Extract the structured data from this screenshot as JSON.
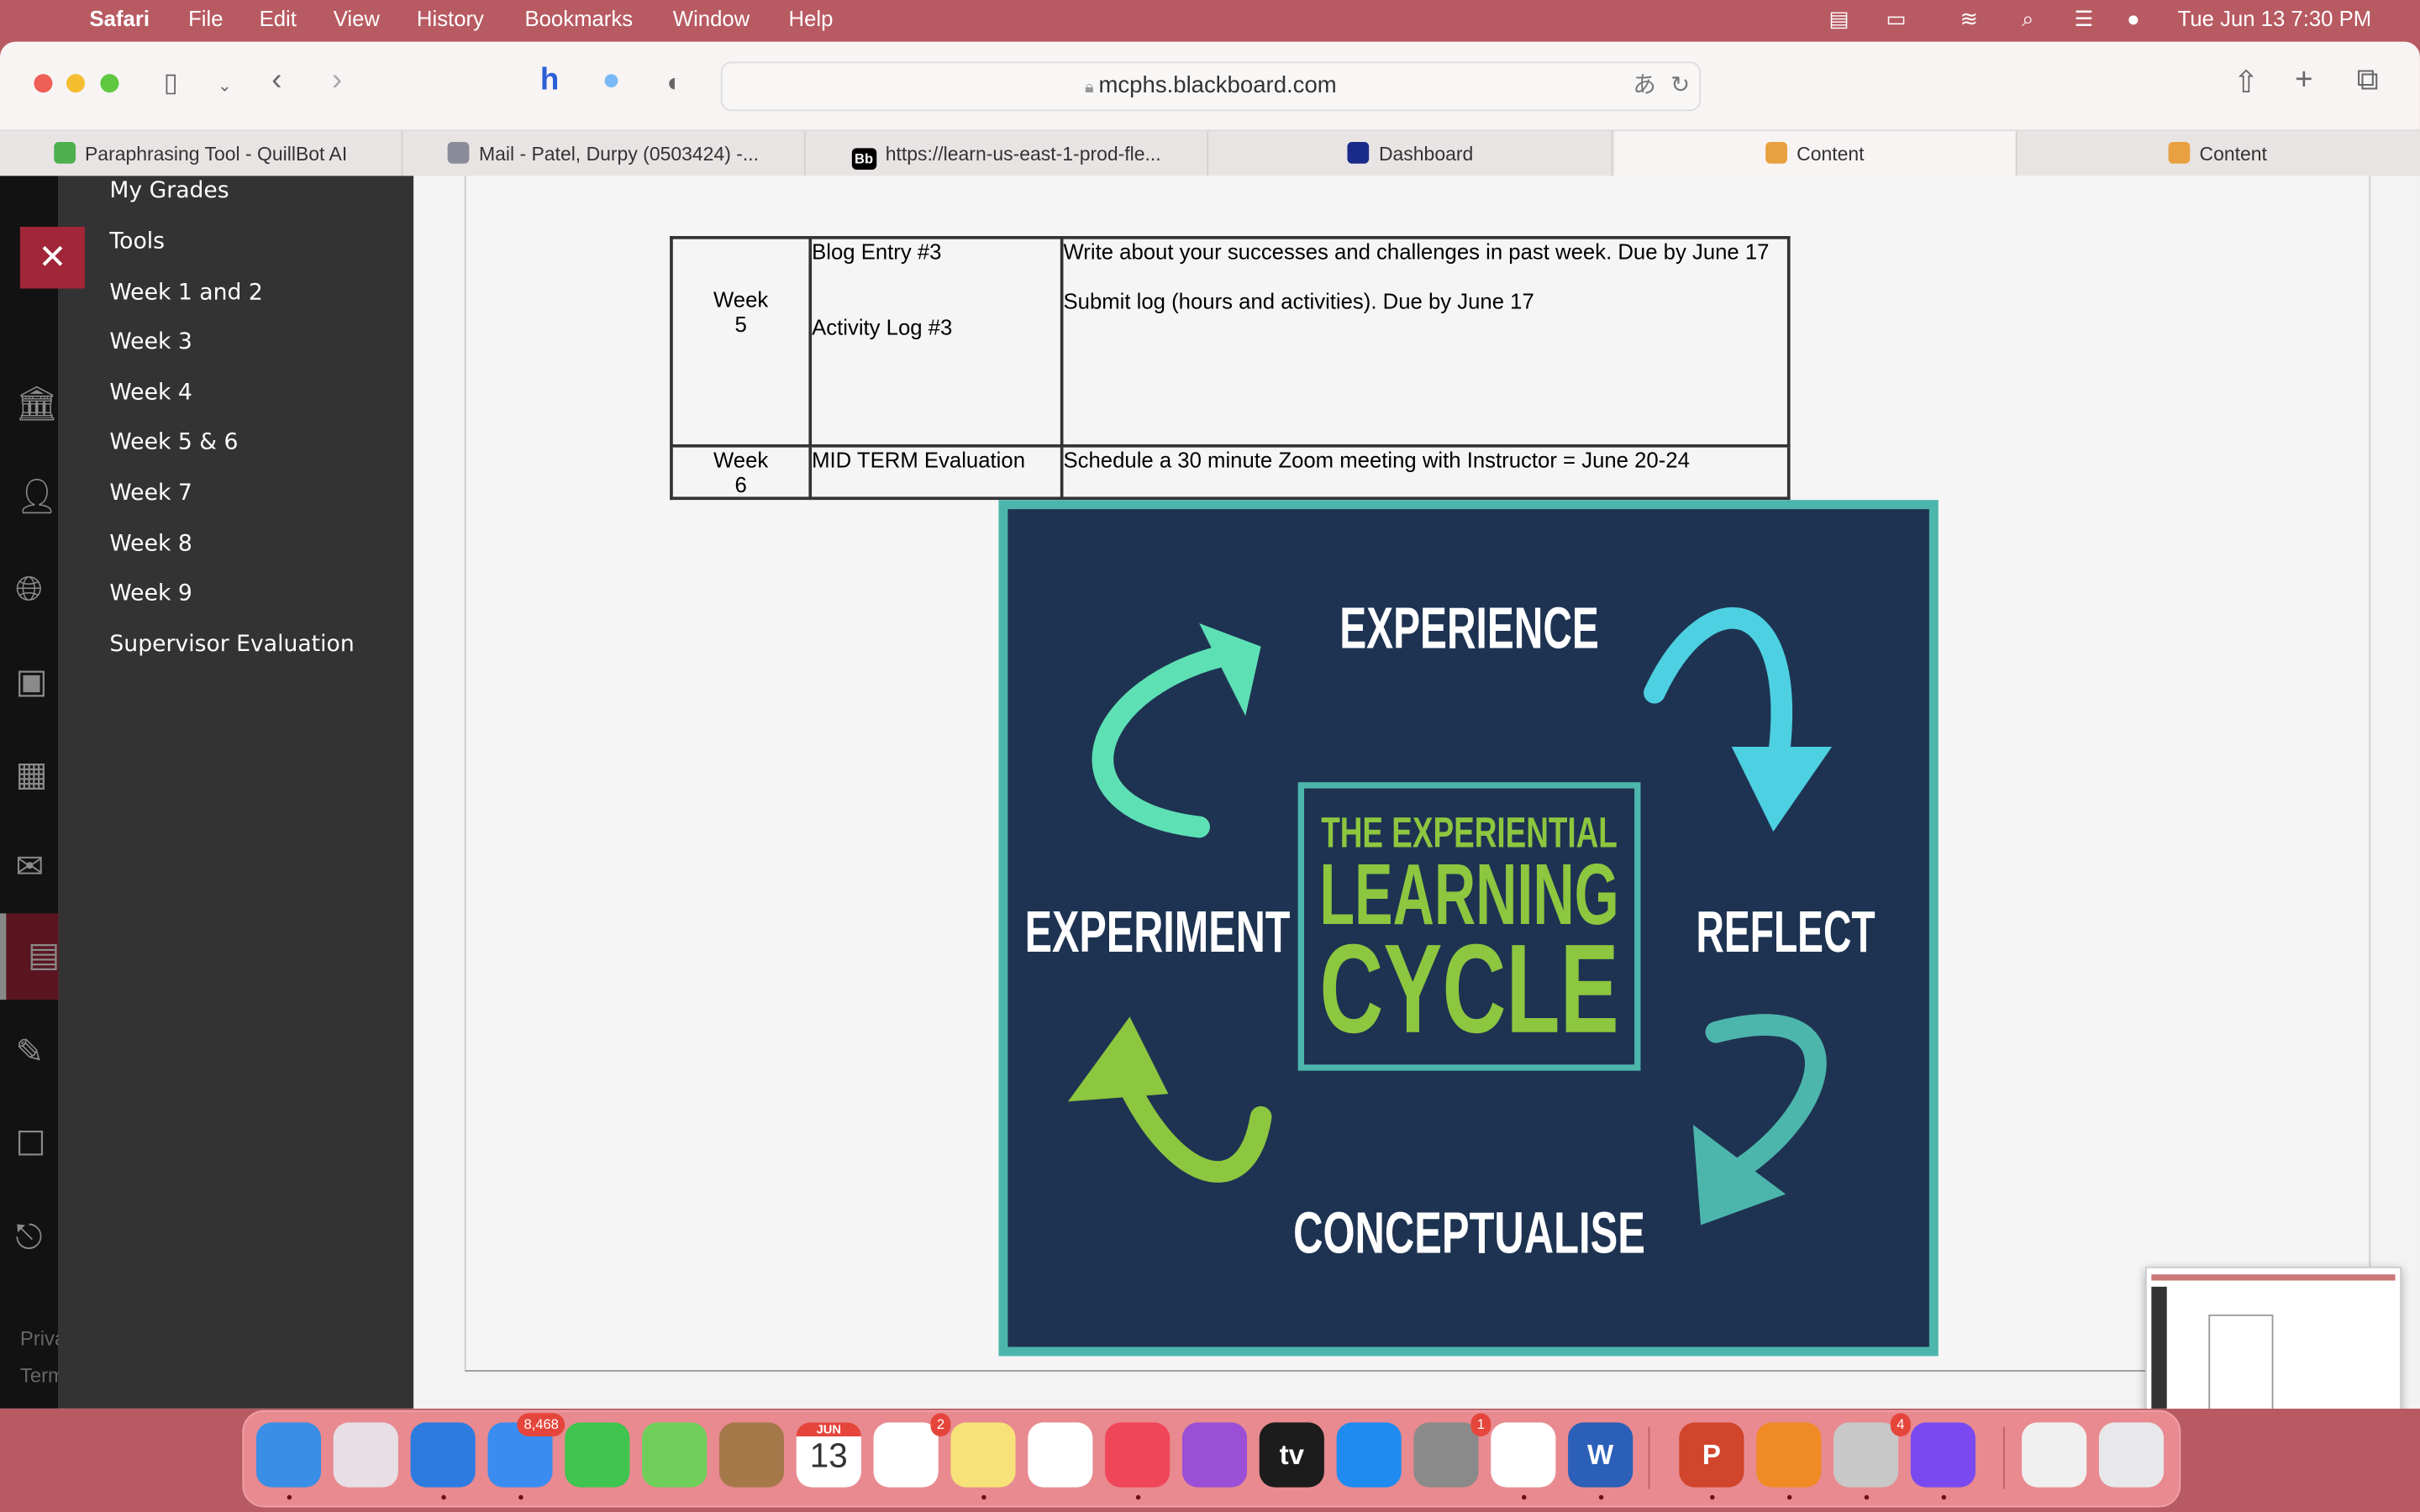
{
  "menubar": {
    "app": "Safari",
    "items": [
      "File",
      "Edit",
      "View",
      "History",
      "Bookmarks",
      "Window",
      "Help"
    ],
    "clock": "Tue Jun 13  7:30 PM"
  },
  "toolbar": {
    "url": "mcphs.blackboard.com"
  },
  "tabs": [
    {
      "label": "Paraphrasing Tool - QuillBot AI",
      "icon": "quillbot-icon",
      "color": "#4caf50"
    },
    {
      "label": "Mail - Patel, Durpy (0503424) -...",
      "icon": "outlook-icon",
      "color": "#8a8d99"
    },
    {
      "label": "https://learn-us-east-1-prod-fle...",
      "icon": "blackboard-icon",
      "color": "#000000",
      "icon_text": "Bb"
    },
    {
      "label": "Dashboard",
      "icon": "dashboard-shield-icon",
      "color": "#1a2a8a"
    },
    {
      "label": "Content",
      "icon": "pencil-icon",
      "color": "#e8a040",
      "active": true
    },
    {
      "label": "Content",
      "icon": "pencil-icon",
      "color": "#e8a040"
    }
  ],
  "sidebar": {
    "items": [
      "My Grades",
      "Tools",
      "Week 1 and 2",
      "Week 3",
      "Week 4",
      "Week 5 & 6",
      "Week 7",
      "Week 8",
      "Week 9",
      "Supervisor Evaluation"
    ],
    "footer": [
      "Priva",
      "Term"
    ],
    "close_label": "✕"
  },
  "schedule": {
    "rows": [
      {
        "week": "Week",
        "num": "5",
        "tasks": [
          "Blog Entry #3",
          "Activity Log #3"
        ],
        "details": [
          "Write about your successes and challenges in past week. Due by June 17",
          "Submit log (hours and activities). Due by June 17"
        ]
      },
      {
        "week": "Week",
        "num": "6",
        "tasks": [
          "MID TERM Evaluation"
        ],
        "details": [
          "Schedule a 30 minute Zoom meeting with Instructor = June 20-24"
        ]
      }
    ]
  },
  "infographic": {
    "title_line1": "THE EXPERIENTIAL",
    "title_line2": "LEARNING",
    "title_line3": "CYCLE",
    "stages": [
      "EXPERIENCE",
      "REFLECT",
      "CONCEPTUALISE",
      "EXPERIMENT"
    ],
    "colors": {
      "bg": "#1e3352",
      "border": "#4db6ac",
      "green": "#8dc63f",
      "teal": "#5ee0b5",
      "cyan": "#4dd0e1"
    }
  },
  "dock": {
    "apps": [
      {
        "name": "Finder",
        "color": "#3a8ee6"
      },
      {
        "name": "Launchpad",
        "color": "#e8dfe6"
      },
      {
        "name": "Safari",
        "color": "#2e7be0"
      },
      {
        "name": "Mail",
        "color": "#3b8cf0",
        "badge": "8,468"
      },
      {
        "name": "FaceTime",
        "color": "#3fc450"
      },
      {
        "name": "Maps",
        "color": "#6fcf5a"
      },
      {
        "name": "Contacts",
        "color": "#a5784a"
      },
      {
        "name": "Calendar",
        "color": "#ffffff",
        "month": "JUN",
        "day": "13"
      },
      {
        "name": "Reminders",
        "color": "#ffffff",
        "badge": "2"
      },
      {
        "name": "Notes",
        "color": "#f7e27a"
      },
      {
        "name": "Freeform",
        "color": "#ffffff"
      },
      {
        "name": "Music",
        "color": "#f0465a"
      },
      {
        "name": "Podcasts",
        "color": "#9a4fd6"
      },
      {
        "name": "TV",
        "color": "#1c1c1c",
        "label": "tv"
      },
      {
        "name": "App Store",
        "color": "#1f8bf0"
      },
      {
        "name": "System Preferences",
        "color": "#8a8a8a",
        "badge": "1"
      },
      {
        "name": "Chrome",
        "color": "#ffffff"
      },
      {
        "name": "Word",
        "color": "#2b5fb8",
        "label": "W"
      },
      {
        "name": "PowerPoint",
        "color": "#d0452b",
        "label": "P"
      },
      {
        "name": "Books",
        "color": "#f08a24"
      },
      {
        "name": "Printer",
        "color": "#c8c8c8",
        "badge": "4"
      },
      {
        "name": "Messenger",
        "color": "#7a4af0"
      },
      {
        "name": "Recent Document",
        "color": "#f0f0f0"
      },
      {
        "name": "Trash",
        "color": "#e8e8ea"
      }
    ]
  }
}
